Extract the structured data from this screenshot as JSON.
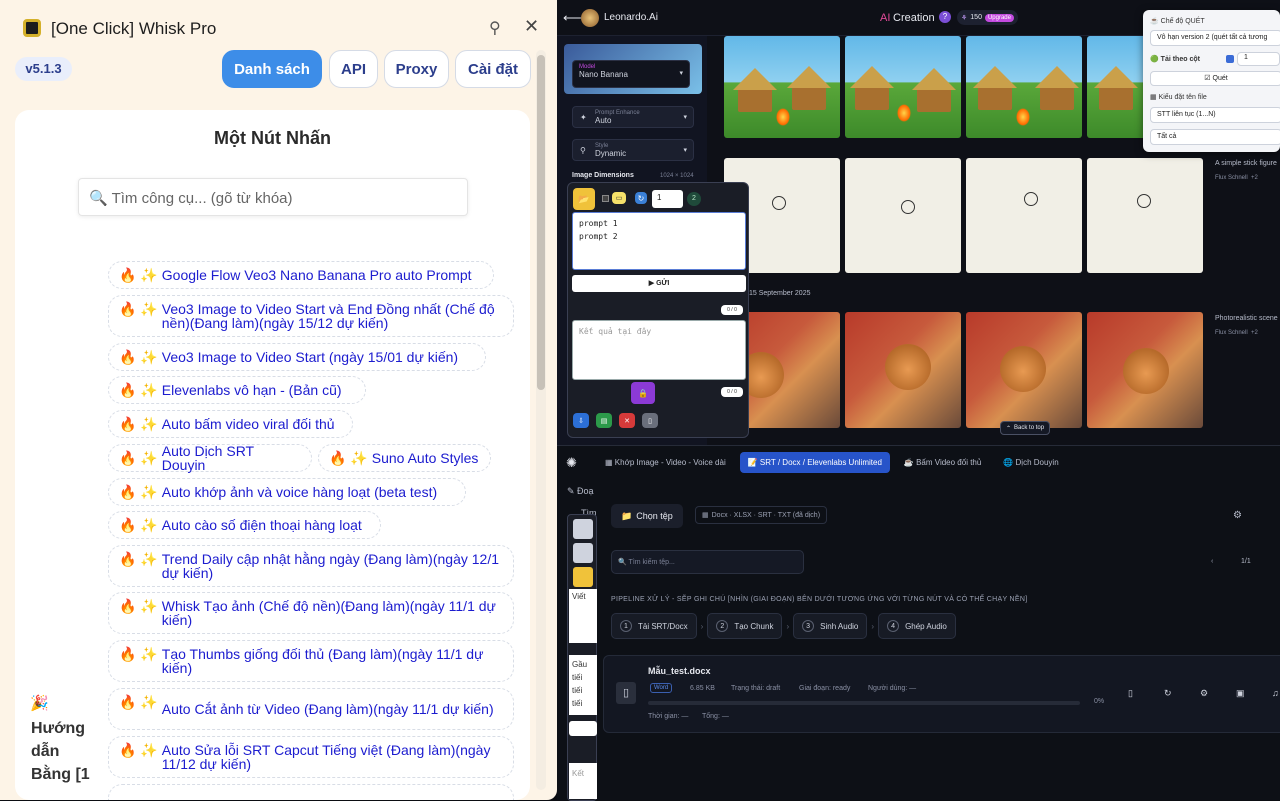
{
  "window": {
    "title": "[One Click] Whisk Pro",
    "version": "v5.1.3",
    "nav": [
      "Danh sách",
      "API",
      "Proxy",
      "Cài đặt"
    ],
    "card_title": "Một Nút Nhấn",
    "search_placeholder": "🔍 Tìm công cụ... (gõ từ khóa)",
    "tool_prefix": "🔥 ✨",
    "tools": [
      "Google Flow Veo3 Nano Banana Pro auto Prompt",
      "Veo3 Image to Video Start và End Đồng nhất (Chế độ nền)(Đang làm)(ngày 15/12 dự kiến)",
      "Veo3 Image to Video Start (ngày 15/01 dự kiến)",
      "Elevenlabs vô hạn - (Bản cũ)",
      "Auto bấm video viral đối thủ",
      "Auto Dịch SRT Douyin",
      "Suno Auto Styles",
      "Auto khớp ảnh và voice hàng loạt (beta test)",
      "Auto cào số điện thoại hàng loạt",
      "Trend Daily cập nhật hằng ngày (Đang làm)(ngày 12/1 dự kiến)",
      "Whisk Tạo ảnh (Chế độ nền)(Đang làm)(ngày 11/1 dự kiến)",
      "Tạo Thumbs giống đối thủ (Đang làm)(ngày 11/1 dự kiến)",
      "Auto Cắt ảnh từ Video (Đang làm)(ngày 11/1 dự kiến)",
      "Auto Sửa lỗi SRT Capcut Tiếng việt (Đang làm)(ngày 11/12 dự kiến)"
    ],
    "guide_emoji": "🎉",
    "guide_lines": [
      "Hướng",
      "dẫn",
      "Bằng [1"
    ]
  },
  "leonardo": {
    "brand": "Leonardo.Ai",
    "center_prefix": "AI",
    "center_title": "Creation",
    "tokens": "150",
    "upgrade": "Upgrade",
    "model_label": "Model",
    "model_value": "Nano Banana",
    "prompt_enhance_label": "Prompt Enhance",
    "prompt_enhance_value": "Auto",
    "style_label": "Style",
    "style_value": "Dynamic",
    "image_dimensions": "Image Dimensions",
    "dimensions_value": "1024 × 1024",
    "row2_caption": "A simple stick figure",
    "row2_model": "Flux Schnell",
    "row2_extra": "+2",
    "date": "15 September 2025",
    "row3_caption": "Photorealistic scene",
    "row3_model": "Flux Schnell",
    "row3_extra": "+2",
    "back_to_top": "Back to top"
  },
  "scan_popup": {
    "mode_label": "Chế độ QUÉT",
    "mode_value": "Vô hạn version 2 (quét tất cả tương",
    "download_col_label": "Tải theo cột",
    "download_col_value": "1",
    "scan_button": "Quét",
    "naming_label": "Kiểu đặt tên file",
    "naming_value": "STT liên tục (1...N)",
    "all_value": "Tất cả"
  },
  "float_panel": {
    "count_value": "1",
    "badge": "2",
    "prompt_text": "prompt 1\nprompt 2",
    "send_button": "GỬI",
    "counter1": "0 / 0",
    "result_placeholder": "Kết quả tại đây",
    "counter2": "0 / 0"
  },
  "bottom_app": {
    "tabs": [
      "Khớp Image - Video - Voice dài",
      "SRT / Docx / Elevenlabs Unlimited",
      "Bấm Video đối thủ",
      "Dịch Douyin"
    ],
    "choose_file": "Chọn tệp",
    "formats": "Docx · XLSX · SRT · TXT (đã dịch)",
    "search_placeholder": "Tìm kiếm tệp...",
    "page": "1/1",
    "pipeline_title": "PIPELINE XỬ LÝ - SẼP GHI CHÚ [NHÌN (GIAI ĐOẠN) BÊN DƯỚI TƯƠNG ỨNG VỚI TỪNG NÚT VÀ CÓ THỂ CHẠY NỀN]",
    "steps": [
      "Tải SRT/Docx",
      "Tạo Chunk",
      "Sinh Audio",
      "Ghép Audio"
    ],
    "file": {
      "name": "Mẫu_test.docx",
      "type": "Word",
      "size": "6.85 KB",
      "status": "Trạng thái: draft",
      "stage": "Giai đoạn: ready",
      "user": "Người dùng: —",
      "progress_pct": 0,
      "progress_text": "0%",
      "time": "Thời gian: —",
      "total": "Tổng: —"
    },
    "side_labels": [
      "Đoạ",
      "Tìm"
    ],
    "left_stub": [
      "Viết",
      "Gầu",
      "tiếi",
      "tiếi",
      "tiếi",
      "Kết"
    ]
  }
}
